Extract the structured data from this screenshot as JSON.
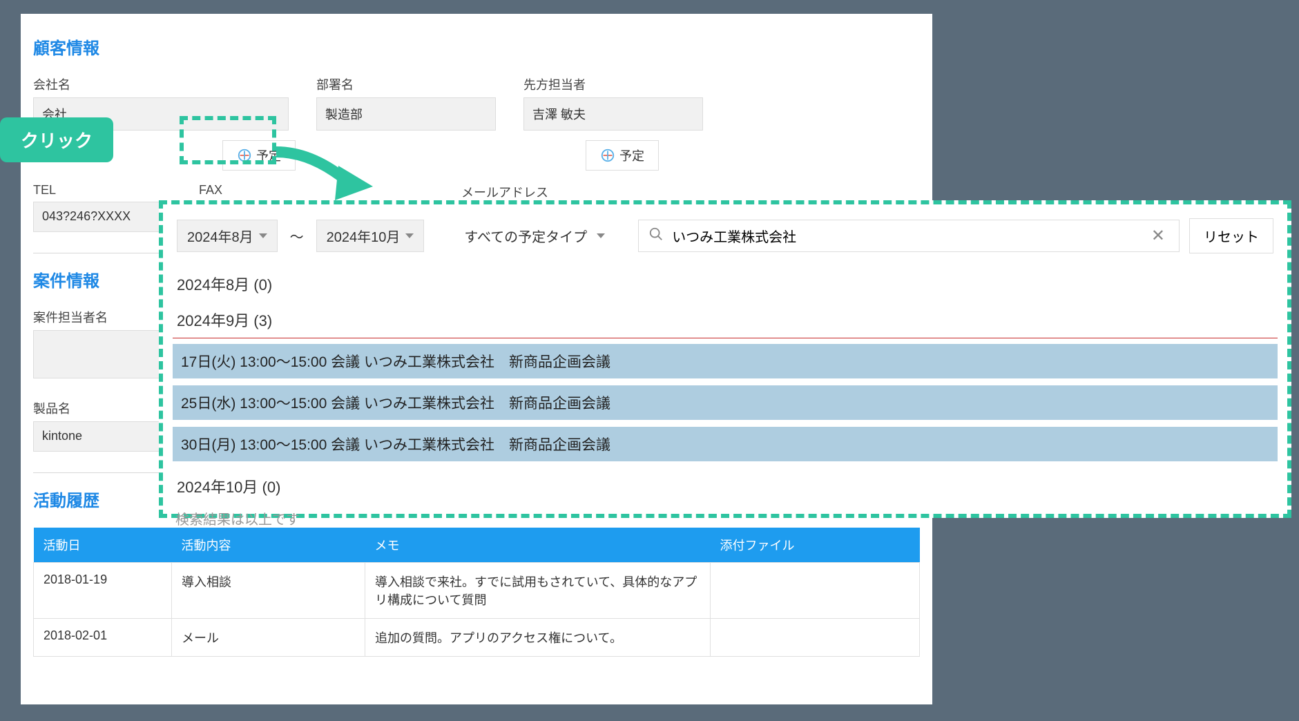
{
  "customer": {
    "section_title": "顧客情報",
    "company_label": "会社名",
    "company_value": "会社",
    "dept_label": "部署名",
    "dept_value": "製造部",
    "contact_label": "先方担当者",
    "contact_value": "吉澤 敏夫",
    "schedule_btn": "予定",
    "tel_label": "TEL",
    "tel_value": "043?246?XXXX",
    "fax_label": "FAX",
    "mail_label": "メールアドレス"
  },
  "callout": {
    "click_label": "クリック"
  },
  "search": {
    "date_from": "2024年8月",
    "date_to": "2024年10月",
    "type_label": "すべての予定タイプ",
    "query": "いつみ工業株式会社",
    "reset": "リセット"
  },
  "results": {
    "groups": [
      {
        "label": "2024年8月 (0)",
        "events": []
      },
      {
        "label": "2024年9月 (3)",
        "events": [
          "17日(火) 13:00〜15:00 会議 いつみ工業株式会社　新商品企画会議",
          "25日(水) 13:00〜15:00 会議 いつみ工業株式会社　新商品企画会議",
          "30日(月) 13:00〜15:00 会議 いつみ工業株式会社　新商品企画会議"
        ]
      },
      {
        "label": "2024年10月 (0)",
        "events": []
      }
    ],
    "end_msg": "検索結果は以上です"
  },
  "case": {
    "section_title": "案件情報",
    "assignee_label": "案件担当者名",
    "product_label": "製品名",
    "product_value": "kintone"
  },
  "activity": {
    "section_title": "活動履歴",
    "headers": {
      "date": "活動日",
      "content": "活動内容",
      "memo": "メモ",
      "attachment": "添付ファイル"
    },
    "rows": [
      {
        "date": "2018-01-19",
        "content": "導入相談",
        "memo": "導入相談で来社。すでに試用もされていて、具体的なアプリ構成について質問",
        "attachment": ""
      },
      {
        "date": "2018-02-01",
        "content": "メール",
        "memo": "追加の質問。アプリのアクセス権について。",
        "attachment": ""
      }
    ]
  }
}
